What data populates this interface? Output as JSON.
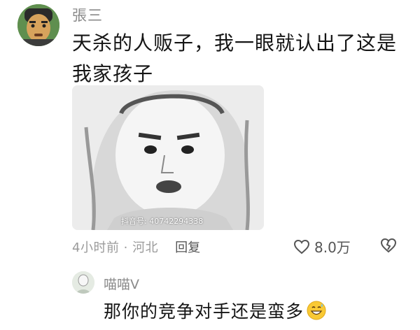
{
  "comment": {
    "username": "張三",
    "text": "天杀的人贩子，我一眼就认出了这是我家孩子",
    "meme": {
      "watermark": "抖音号: 40742294338"
    },
    "time_location": "4小时前 · 河北",
    "reply_label": "回复",
    "likes": "8.0万",
    "icons": {
      "like": "heart-outline-icon",
      "dislike": "broken-heart-icon"
    }
  },
  "reply": {
    "username": "喵喵V",
    "text": "那你的竞争对手还是蛮多",
    "emoji": "grinning-sweat-emoji"
  },
  "colors": {
    "meta_gray": "#9a9a9a",
    "text": "#151515"
  }
}
